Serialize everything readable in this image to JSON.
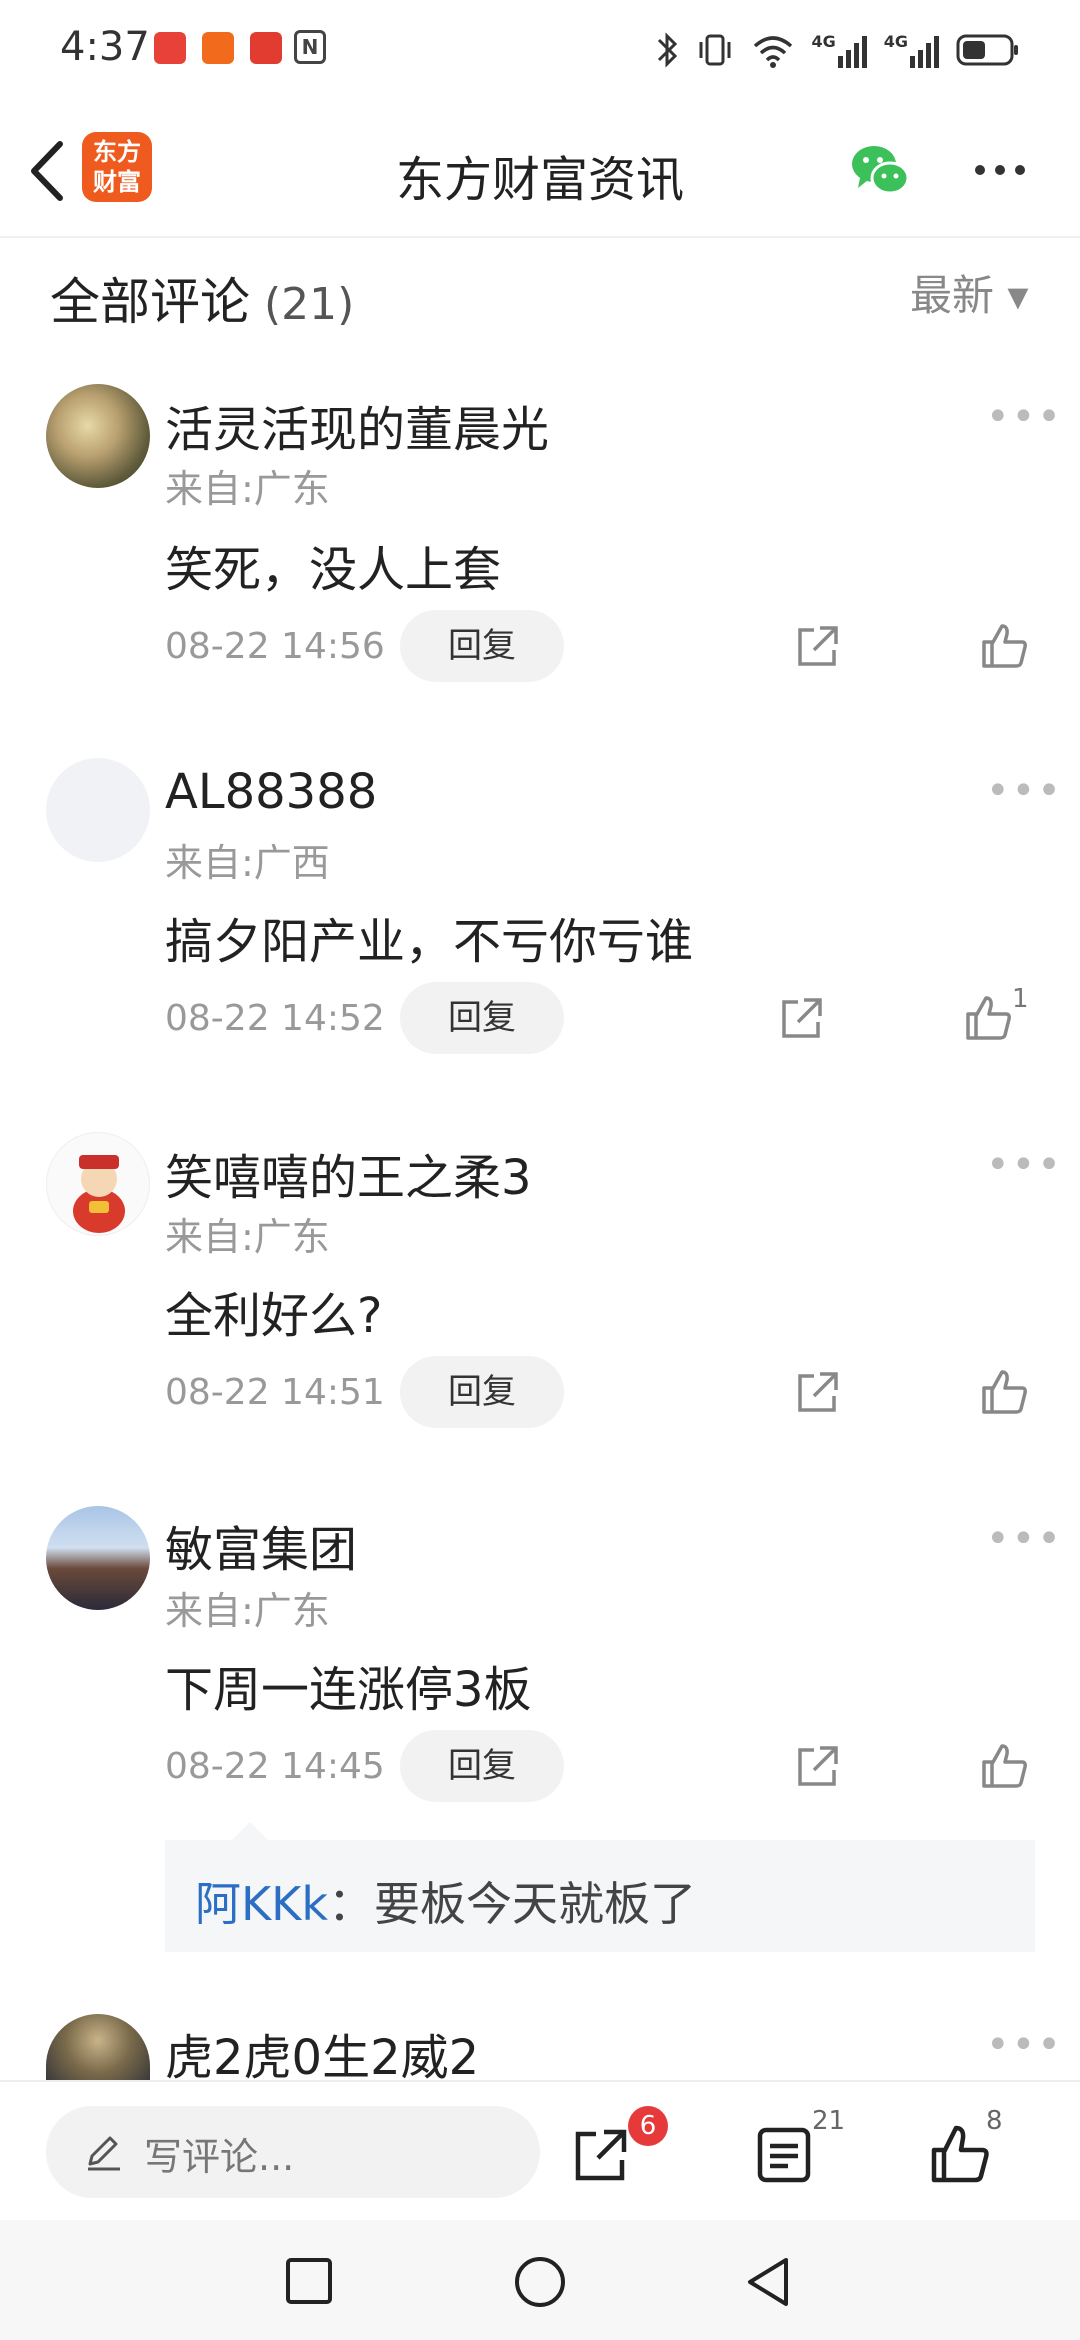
{
  "status_bar": {
    "time": "4:37",
    "nfc": "N",
    "signal_label_1": "4G",
    "signal_label_2": "4G"
  },
  "header": {
    "title": "东方财富资讯",
    "logo_text": "东方财富"
  },
  "comments_header": {
    "title": "全部评论",
    "count": "(21)",
    "sort": "最新 ▾"
  },
  "comments": [
    {
      "user": "活灵活现的董晨光",
      "location": "来自:广东",
      "text": "笑死，没人上套",
      "time": "08-22 14:56",
      "reply": "回复",
      "likes": ""
    },
    {
      "user": "AL88388",
      "location": "来自:广西",
      "text": "搞夕阳产业，不亏你亏谁",
      "time": "08-22 14:52",
      "reply": "回复",
      "likes": "1"
    },
    {
      "user": "笑嘻嘻的王之柔3",
      "location": "来自:广东",
      "text": "全利好么?",
      "time": "08-22 14:51",
      "reply": "回复",
      "likes": ""
    },
    {
      "user": "敏富集团",
      "location": "来自:广东",
      "text": "下周一连涨停3板",
      "time": "08-22 14:45",
      "reply": "回复",
      "likes": ""
    },
    {
      "user": "虎2虎0生2威2",
      "location": "",
      "text": "",
      "time": "",
      "reply": "",
      "likes": ""
    }
  ],
  "sub_reply": {
    "user": "阿KKk",
    "text": "：要板今天就板了"
  },
  "bottom_bar": {
    "placeholder": "写评论...",
    "share_badge": "6",
    "comment_count": "21",
    "like_count": "8"
  },
  "colors": {
    "brand": "#ef5a1f",
    "link": "#2a6fc4",
    "badge": "#e63a3a",
    "wechat": "#3cc15a"
  }
}
